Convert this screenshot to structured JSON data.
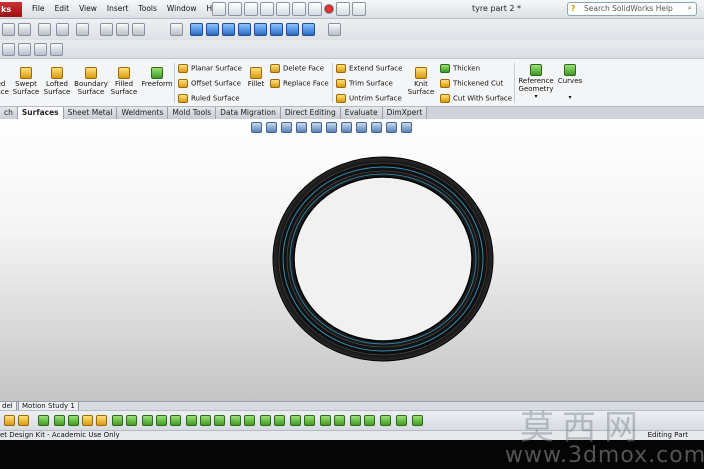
{
  "app": {
    "logo_text": "ks",
    "document_title": "tyre part 2 *"
  },
  "menu": [
    "File",
    "Edit",
    "View",
    "Insert",
    "Tools",
    "Window",
    "Help"
  ],
  "help_search": {
    "placeholder": "Search SolidWorks Help"
  },
  "ribbon": {
    "large_buttons": [
      {
        "label": "ed\nface",
        "icon": "extruded-surface-icon"
      },
      {
        "label": "Swept\nSurface",
        "icon": "swept-surface-icon"
      },
      {
        "label": "Lofted\nSurface",
        "icon": "lofted-surface-icon"
      },
      {
        "label": "Boundary\nSurface",
        "icon": "boundary-surface-icon"
      },
      {
        "label": "Filled\nSurface",
        "icon": "filled-surface-icon"
      },
      {
        "label": "Freeform",
        "icon": "freeform-icon"
      },
      {
        "label": "Fillet",
        "icon": "fillet-icon"
      },
      {
        "label": "Knit\nSurface",
        "icon": "knit-surface-icon"
      },
      {
        "label": "Reference\nGeometry",
        "icon": "reference-geometry-icon"
      },
      {
        "label": "Curves",
        "icon": "curves-icon"
      }
    ],
    "surface_group_1": [
      "Planar Surface",
      "Offset Surface",
      "Ruled Surface"
    ],
    "face_group": [
      "Delete Face",
      "Replace Face"
    ],
    "surface_group_2": [
      "Extend Surface",
      "Trim Surface",
      "Untrim Surface"
    ],
    "solid_group": [
      "Thicken",
      "Thickened Cut",
      "Cut With Surface"
    ]
  },
  "tabs": {
    "items": [
      "ch",
      "Surfaces",
      "Sheet Metal",
      "Weldments",
      "Mold Tools",
      "Data Migration",
      "Direct Editing",
      "Evaluate",
      "DimXpert"
    ],
    "active": "Surfaces"
  },
  "bottom_tabs": [
    "del",
    "Motion Study 1"
  ],
  "status": {
    "left": "et Design Kit - Academic Use Only",
    "right": "Editing Part"
  },
  "watermark": {
    "chinese": "莫西网",
    "url": "www.3dmox.com"
  },
  "colors": {
    "tyre": "#0f0f0f",
    "tyre_stripe": "#2f8fb6",
    "viewport_top": "#ffffff",
    "viewport_bottom": "#c4c4c4"
  }
}
